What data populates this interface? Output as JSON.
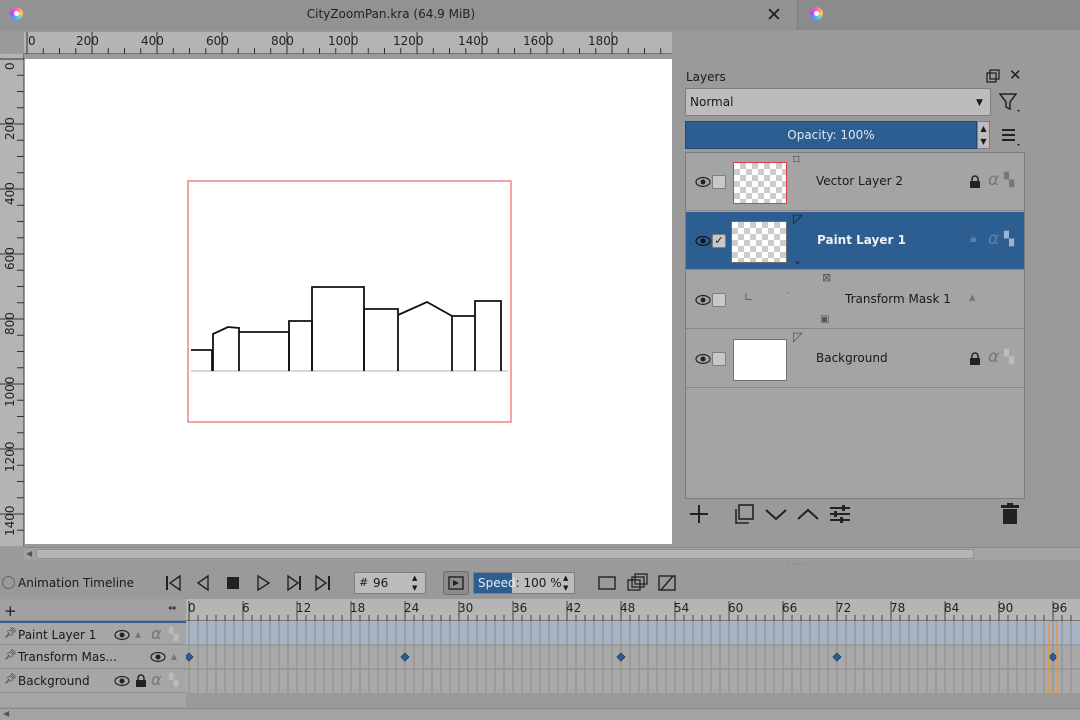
{
  "window": {
    "title": "CityZoomPan.kra (64.9 MiB)"
  },
  "rulers": {
    "horizontal": [
      "0",
      "200",
      "400",
      "600",
      "800",
      "1000",
      "1200",
      "1400",
      "1600",
      "1800"
    ],
    "vertical": [
      "0",
      "200",
      "400",
      "600",
      "800",
      "1000",
      "1200",
      "1400"
    ]
  },
  "layers_docker": {
    "title": "Layers",
    "blend_mode": "Normal",
    "opacity": "Opacity:  100%",
    "layers": [
      {
        "name": "Vector Layer 2",
        "selected": false,
        "visible": true
      },
      {
        "name": "Paint Layer 1",
        "selected": true,
        "visible": true
      },
      {
        "name": "Transform Mask 1",
        "selected": false,
        "visible": true
      },
      {
        "name": "Background",
        "selected": false,
        "visible": true
      }
    ]
  },
  "timeline": {
    "title": "Animation Timeline",
    "frame_hash": "#",
    "current_frame": "96",
    "speed_prefix": "Speed",
    "speed_rest": ": 100 %",
    "frame_ruler": [
      "0",
      "6",
      "12",
      "18",
      "24",
      "30",
      "36",
      "42",
      "48",
      "54",
      "60",
      "66",
      "72",
      "78",
      "84",
      "90",
      "96"
    ],
    "rows": [
      {
        "name": "Paint Layer 1"
      },
      {
        "name": "Transform Mas..."
      },
      {
        "name": "Background"
      }
    ],
    "keyframes_transform_mask": [
      0,
      24,
      48,
      72,
      96
    ]
  },
  "colors": {
    "accent": "#2d5e91",
    "playhead": "#e8973a"
  }
}
